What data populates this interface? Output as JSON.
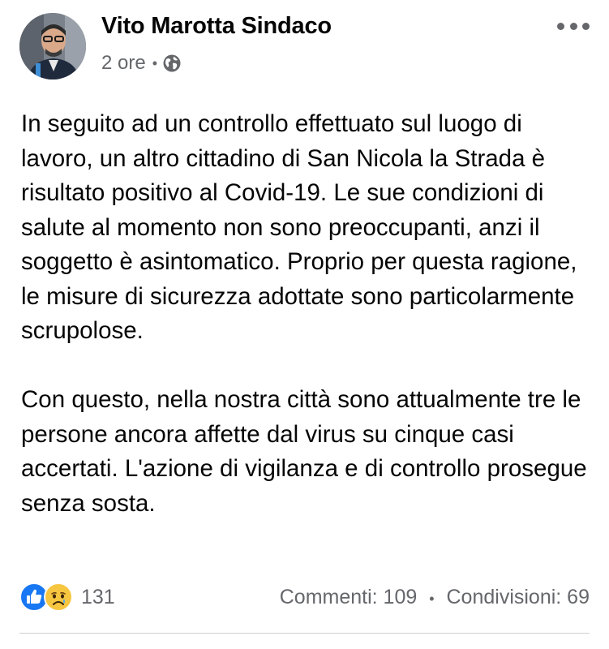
{
  "post": {
    "author": "Vito Marotta Sindaco",
    "time": "2 ore",
    "separator": "•",
    "privacy_icon": "globe-icon",
    "paragraphs": [
      "In seguito ad un controllo effettuato sul luogo di lavoro, un altro cittadino di San Nicola la Strada è risultato positivo al Covid-19. Le sue condizioni di salute al momento non sono preoccupanti, anzi il soggetto è asintomatico. Proprio per questa ragione, le misure di sicurezza adottate sono particolarmente scrupolose.",
      "Con questo, nella nostra città sono attualmente tre le persone ancora affette dal virus su cinque casi accertati. L'azione di vigilanza e di controllo prosegue senza sosta."
    ]
  },
  "reactions": {
    "icons": [
      "like-icon",
      "sad-icon"
    ],
    "count": "131"
  },
  "stats": {
    "comments": "Commenti: 109",
    "separator": "•",
    "shares": "Condivisioni: 69"
  },
  "colors": {
    "text": "#050505",
    "secondary": "#65676b",
    "like_blue": "#1877f2",
    "sad_yellow": "#f7c640",
    "divider": "#ced0d4"
  }
}
